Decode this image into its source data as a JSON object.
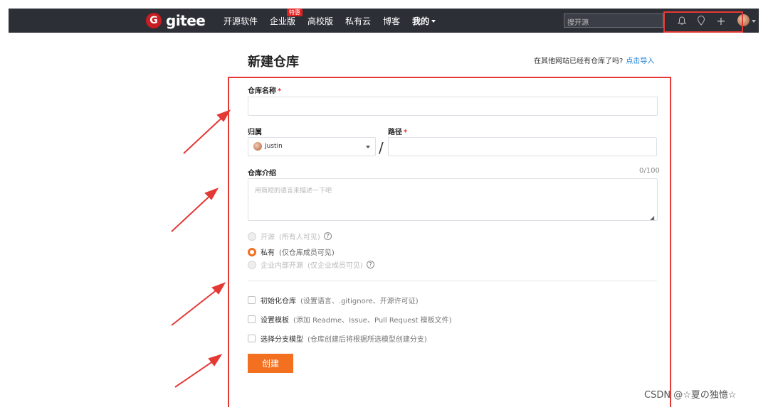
{
  "nav": {
    "logo_mark": "G",
    "logo_text": "gitee",
    "items": [
      "开源软件",
      "企业版",
      "高校版",
      "私有云",
      "博客",
      "我的"
    ],
    "hot_badge": "特惠",
    "search_placeholder": "搜开源"
  },
  "page": {
    "title": "新建仓库",
    "import_text": "在其他网站已经有仓库了吗?",
    "import_link": "点击导入"
  },
  "form": {
    "repo_name_label": "仓库名称",
    "required_mark": "*",
    "owner_label": "归属",
    "owner_value": "Justin",
    "path_label": "路径",
    "slash": "/",
    "desc_label": "仓库介绍",
    "desc_counter": "0/100",
    "desc_placeholder": "用简短的语言来描述一下吧",
    "visibility": [
      {
        "label": "开源",
        "hint": "(所有人可见)",
        "selected": false,
        "help": true
      },
      {
        "label": "私有",
        "hint": "(仅仓库成员可见)",
        "selected": true,
        "help": false
      },
      {
        "label": "企业内部开源",
        "hint": "(仅企业成员可见)",
        "selected": false,
        "help": true
      }
    ],
    "options": [
      {
        "label": "初始化仓库",
        "hint": "(设置语言、.gitignore、开源许可证)",
        "checked": false
      },
      {
        "label": "设置模板",
        "hint": "(添加 Readme、Issue、Pull Request 模板文件)",
        "checked": false
      },
      {
        "label": "选择分支模型",
        "hint": "(仓库创建后将根据所选模型创建分支)",
        "checked": false
      }
    ],
    "create_button": "创建"
  },
  "watermark": "CSDN @☆夏の独憶☆",
  "colors": {
    "nav_bg": "#2c2f36",
    "accent": "#f27020",
    "annotation": "#e53935",
    "link": "#1f7fd6"
  }
}
